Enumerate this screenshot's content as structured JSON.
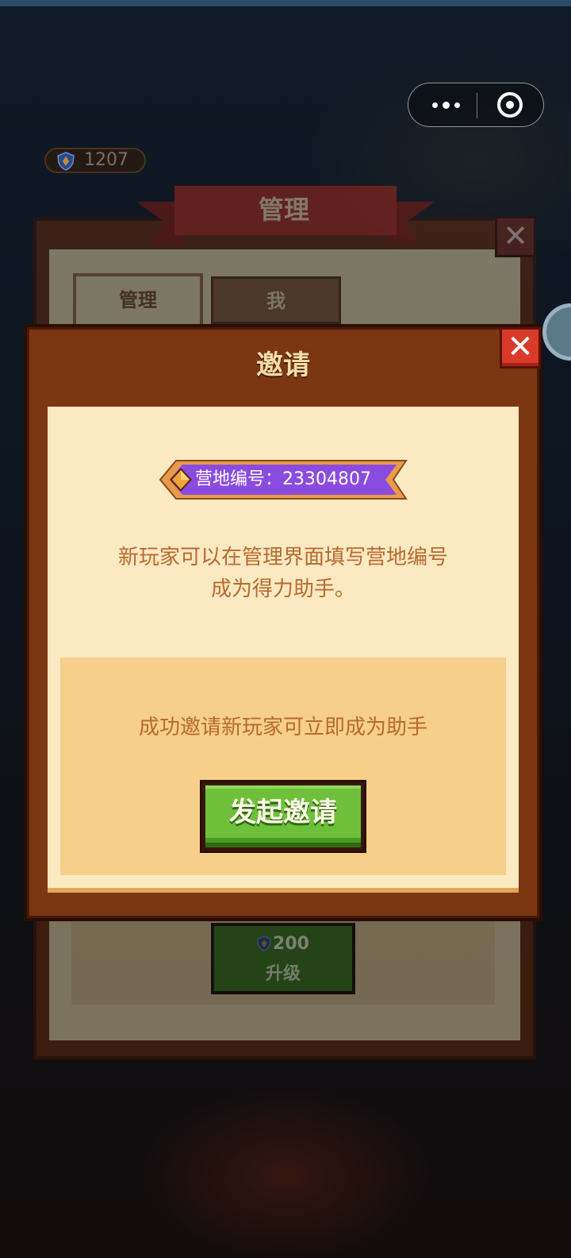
{
  "currency": {
    "amount": "1207"
  },
  "background_panel": {
    "title": "管理",
    "tabs": [
      "管理",
      "我"
    ],
    "upgrade": {
      "cost": "200",
      "label": "升级"
    }
  },
  "invite_modal": {
    "title": "邀请",
    "camp_id_label": "营地编号",
    "camp_id": "23304807",
    "camp_id_text": "营地编号：23304807",
    "description_lines": [
      "新玩家可以在管理界面填写营地编号",
      "成为得力助手。"
    ],
    "reward_text": "成功邀请新玩家可立即成为助手",
    "invite_button": "发起邀请"
  },
  "colors": {
    "accent_green": "#6ec03a",
    "badge_purple": "#8a4be0",
    "close_red": "#d93a2a",
    "panel_brown": "#7a3712"
  }
}
